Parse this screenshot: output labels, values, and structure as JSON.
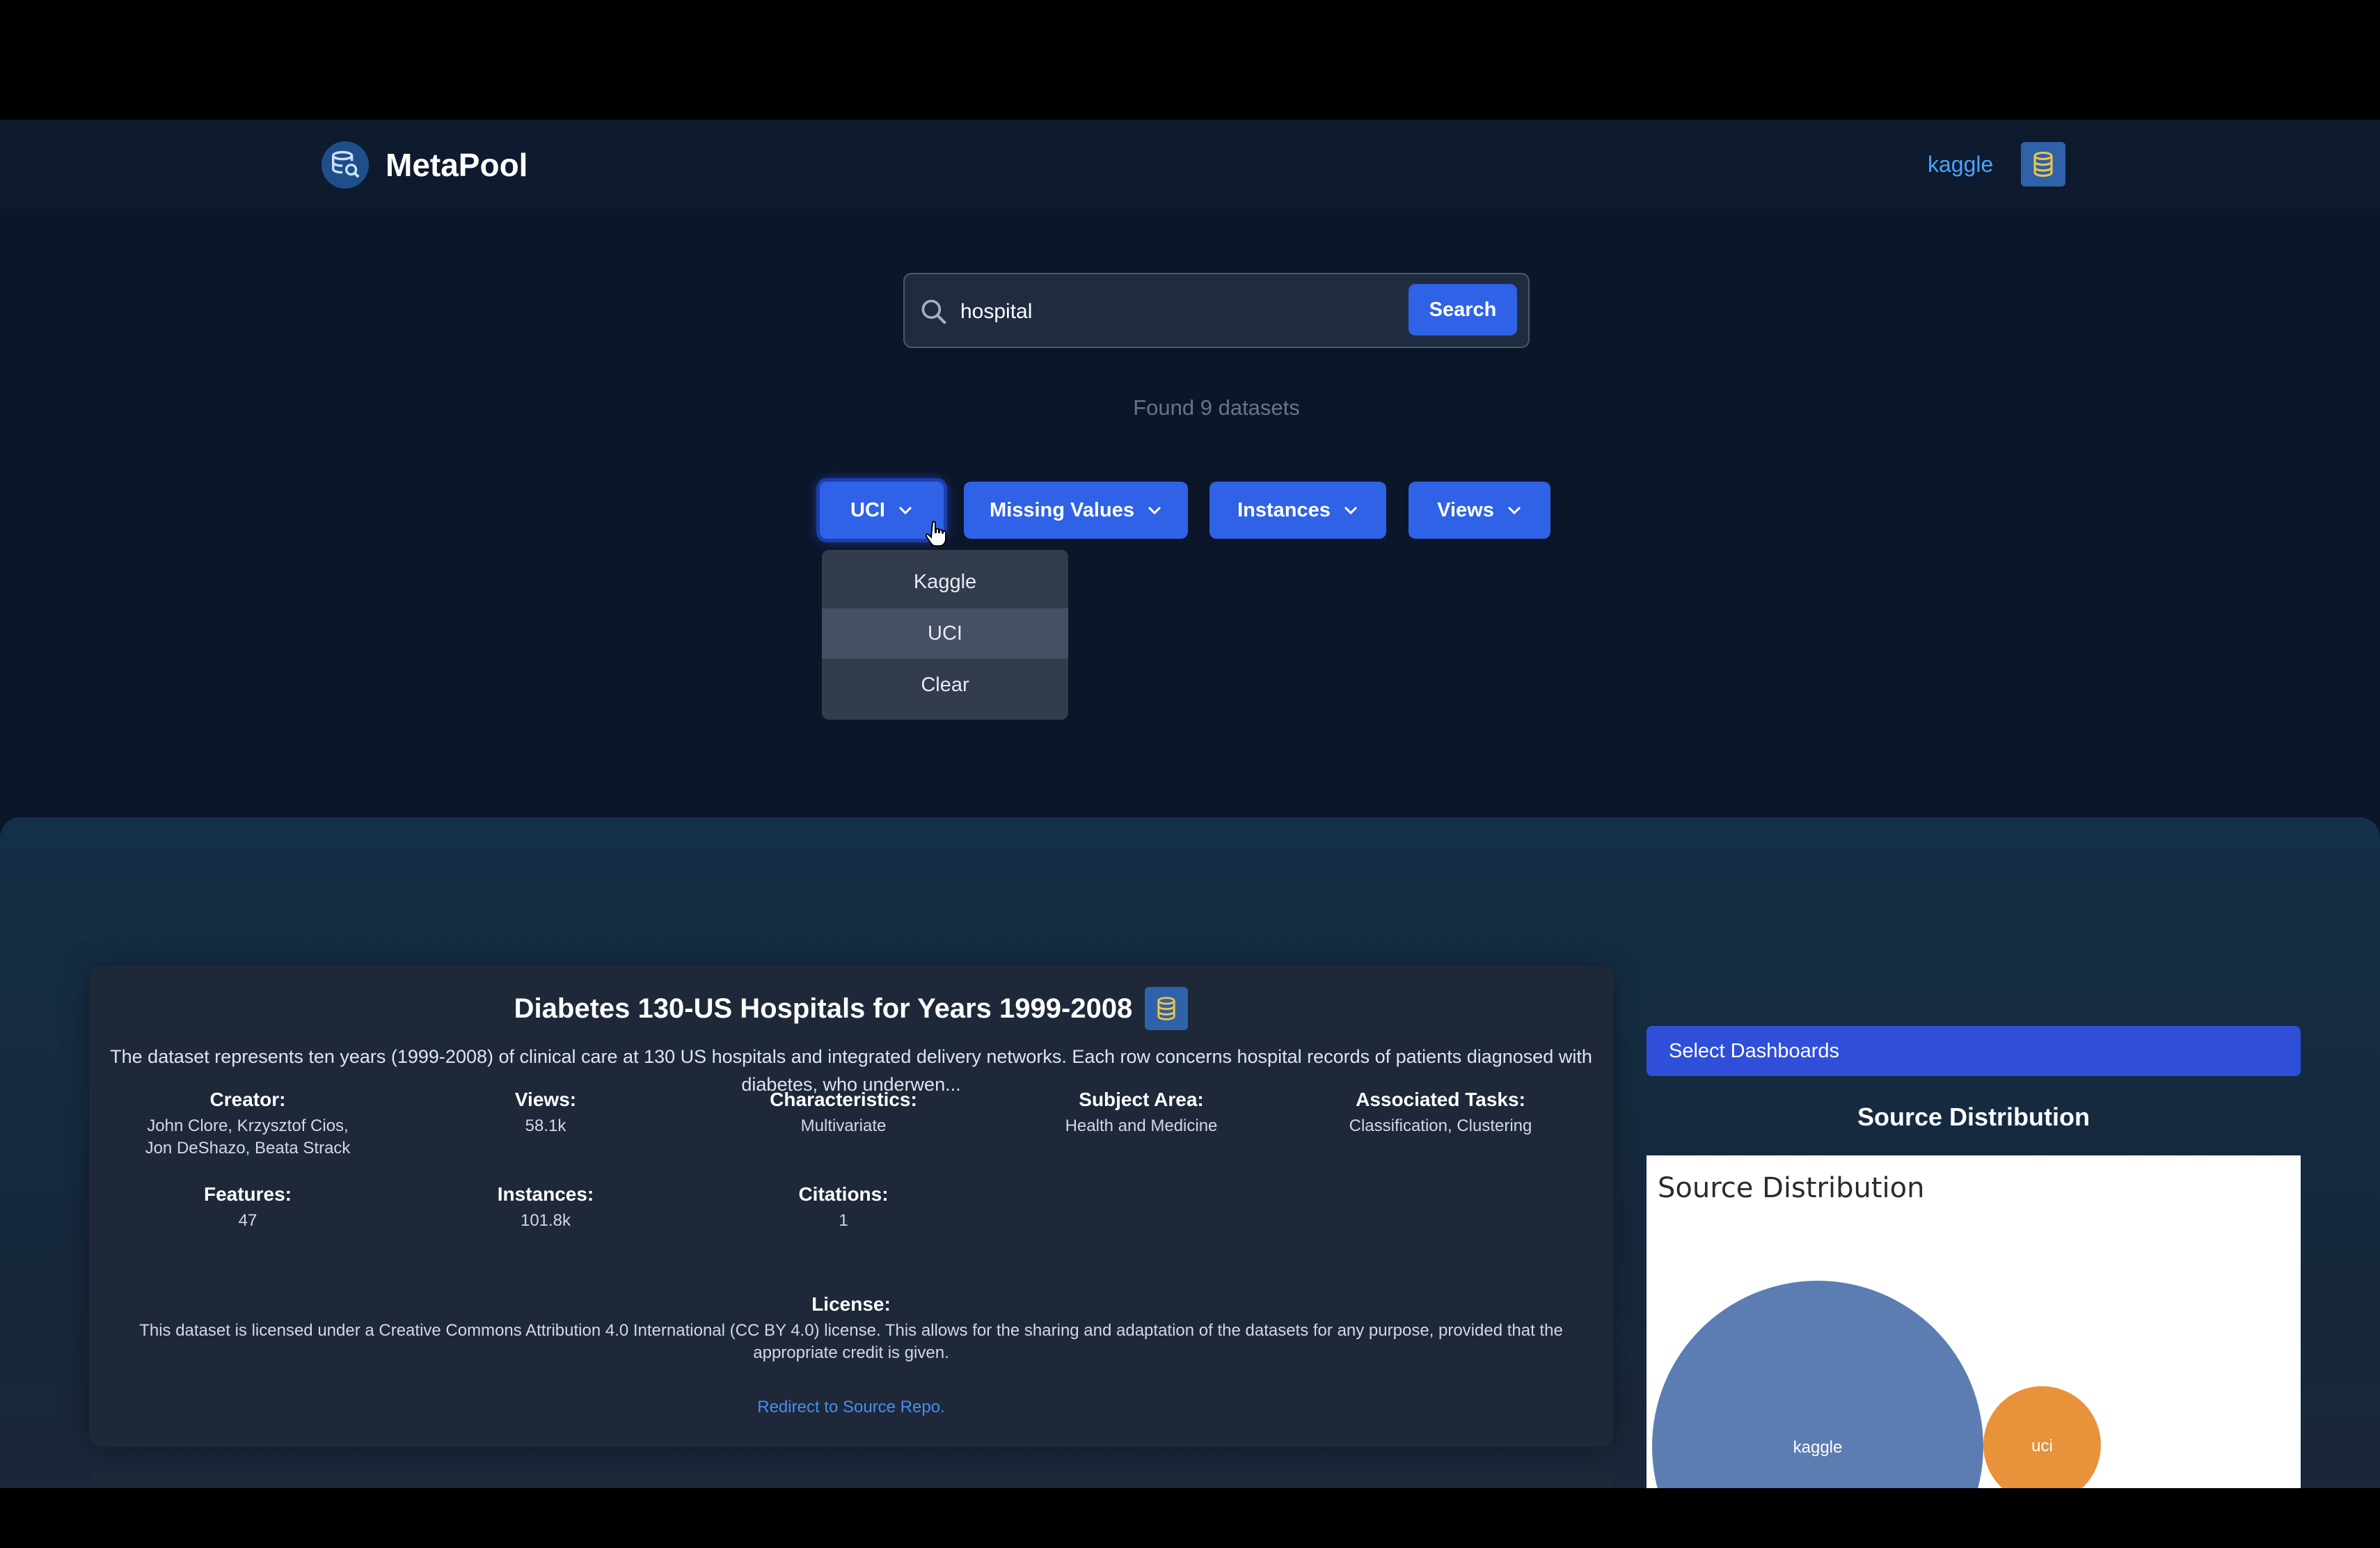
{
  "header": {
    "brand_name": "MetaPool",
    "nav_link": "kaggle"
  },
  "search": {
    "value": "hospital",
    "button_label": "Search",
    "result_count_text": "Found 9 datasets"
  },
  "filters": [
    {
      "label": "UCI",
      "active": true
    },
    {
      "label": "Missing Values"
    },
    {
      "label": "Instances"
    },
    {
      "label": "Views"
    }
  ],
  "dropdown": {
    "items": [
      "Kaggle",
      "UCI",
      "Clear"
    ],
    "hovered": "UCI"
  },
  "dataset": {
    "title": "Diabetes 130-US Hospitals for Years 1999-2008",
    "description": "The dataset represents ten years (1999-2008) of clinical care at 130 US hospitals and integrated delivery networks. Each row concerns hospital records of patients diagnosed with diabetes, who underwen...",
    "creator_label": "Creator:",
    "creator": "John Clore, Krzysztof Cios, Jon DeShazo, Beata Strack",
    "views_label": "Views:",
    "views": "58.1k",
    "characteristics_label": "Characteristics:",
    "characteristics": "Multivariate",
    "subject_area_label": "Subject Area:",
    "subject_area": "Health and Medicine",
    "associated_tasks_label": "Associated Tasks:",
    "associated_tasks": "Classification, Clustering",
    "features_label": "Features:",
    "features": "47",
    "instances_label": "Instances:",
    "instances": "101.8k",
    "citations_label": "Citations:",
    "citations": "1",
    "license_label": "License:",
    "license": "This dataset is licensed under a Creative Commons Attribution 4.0 International (CC BY 4.0) license. This allows for the sharing and adaptation of the datasets for any purpose, provided that the appropriate credit is given.",
    "redirect_label": "Redirect to Source Repo."
  },
  "sidebar": {
    "select_dashboards_label": "Select Dashboards",
    "section_title": "Source Distribution",
    "chart_heading": "Source Distribution"
  },
  "colors": {
    "accent": "#2f62e6",
    "kaggle_bubble": "#5b7db1",
    "uci_bubble": "#e8923a"
  },
  "chart_data": {
    "type": "bubble",
    "title": "Source Distribution",
    "categories": [
      "kaggle",
      "uci"
    ],
    "relative_size": [
      1.0,
      0.126
    ]
  }
}
